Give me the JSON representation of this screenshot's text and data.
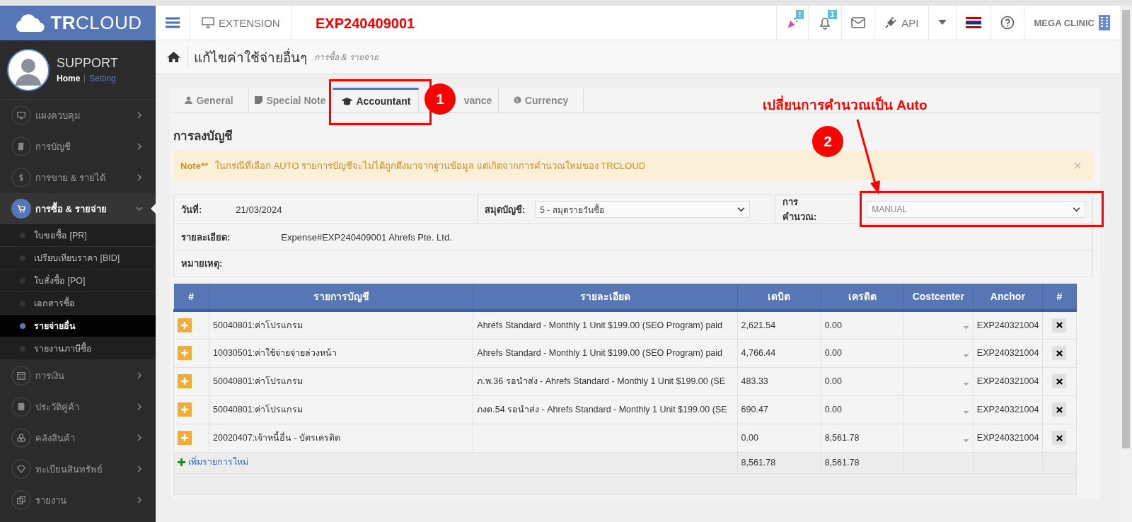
{
  "logo": "**TR**CLOUD",
  "header": {
    "extension": "EXTENSION",
    "items": [
      {
        "kind": "party",
        "badge": "!"
      },
      {
        "kind": "bell",
        "badge": "1"
      },
      {
        "kind": "mail"
      },
      {
        "kind": "api",
        "label": "API"
      },
      {
        "kind": "caret"
      },
      {
        "kind": "flag"
      },
      {
        "kind": "help"
      },
      {
        "kind": "company",
        "label": "MEGA CLINIC"
      }
    ]
  },
  "profile": {
    "name": "SUPPORT",
    "links": [
      {
        "label": "Home",
        "selected": true
      },
      {
        "label": "Setting",
        "selected": false
      }
    ]
  },
  "sidebar": {
    "items": [
      {
        "label": "แผงควบคุม",
        "selected": false,
        "expanded": false
      },
      {
        "label": "การบัญชี",
        "selected": false,
        "expanded": false
      },
      {
        "label": "การขาย & รายได้",
        "selected": false,
        "expanded": false
      },
      {
        "label": "การซื้อ & รายจ่าย",
        "selected": true,
        "expanded": true,
        "children": [
          {
            "label": "ใบขอซื้อ [PR]",
            "selected": false
          },
          {
            "label": "เปรียบเทียบราคา [BID]",
            "selected": false
          },
          {
            "label": "ใบสั่งซื้อ [PO]",
            "selected": false
          },
          {
            "label": "เอกสารซื้อ",
            "selected": false
          },
          {
            "label": "รายจ่ายอื่น",
            "selected": true
          },
          {
            "label": "รายงานภาษีซื้อ",
            "selected": false
          }
        ]
      },
      {
        "label": "การเงิน",
        "selected": false,
        "expanded": false
      },
      {
        "label": "ประวัติคู่ค้า",
        "selected": false,
        "expanded": false
      },
      {
        "label": "คลังสินค้า",
        "selected": false,
        "expanded": false
      },
      {
        "label": "ทะเบียนสินทรัพย์",
        "selected": false,
        "expanded": false
      },
      {
        "label": "รายงาน",
        "selected": false,
        "expanded": false
      }
    ]
  },
  "breadcrumb": {
    "title": "แก้ไขค่าใช้จ่ายอื่นๆ",
    "section": "การซื้อ & รายจ่าย"
  },
  "tabs": [
    {
      "label": "General",
      "selected": false
    },
    {
      "label": "Special Note",
      "selected": false
    },
    {
      "label": "Accountant",
      "selected": true
    },
    {
      "label": "vance",
      "selected": false
    },
    {
      "label": "Currency",
      "selected": false
    }
  ],
  "section_title": "การลงบัญชี",
  "alert": {
    "label": "Note**",
    "text": "ในกรณีที่เลือก AUTO รายการบัญชีจะไม่ได้ถูกดึงมาจากฐานข้อมูล แต่เกิดจากการคำนวณใหม่ของ TRCLOUD",
    "close": "×"
  },
  "form": {
    "date_label": "วันที่:",
    "date": "21/03/2024",
    "book_label": "สมุดบัญชี:",
    "book": "5 - สมุดรายวันซื้อ",
    "calc_label": "การคำนวณ:",
    "calc": "MANUAL",
    "detail_label": "รายละเอียด:",
    "detail": "Expense#EXP240409001  Ahrefs Pte. Ltd.",
    "note_label": "หมายเหตุ:"
  },
  "table": {
    "columns": [
      "#",
      "รายการบัญชี",
      "รายละเอียด",
      "เดบิต",
      "เครดิต",
      "Costcenter",
      "Anchor",
      "#"
    ],
    "rows": [
      {
        "account": "50040801:ค่าโปรแกรม",
        "detail": "Ahrefs Standard - Monthly 1 Unit $199.00 (SEO Program) paid",
        "debit": "2,621.54",
        "credit": "0.00",
        "anchor": "EXP240321004"
      },
      {
        "account": "10030501:ค่าใช้จ่ายจ่ายล่วงหน้า",
        "detail": "Ahrefs Standard - Monthly 1 Unit $199.00 (SEO Program) paid",
        "debit": "4,766.44",
        "credit": "0.00",
        "anchor": "EXP240321004"
      },
      {
        "account": "50040801:ค่าโปรแกรม",
        "detail": "ภ.พ.36 รอนำส่ง - Ahrefs Standard - Monthly 1 Unit $199.00 (SE",
        "debit": "483.33",
        "credit": "0.00",
        "anchor": "EXP240321004"
      },
      {
        "account": "50040801:ค่าโปรแกรม",
        "detail": "ภงด.54 รอนำส่ง - Ahrefs Standard - Monthly 1 Unit $199.00 (SE",
        "debit": "690.47",
        "credit": "0.00",
        "anchor": "EXP240321004"
      },
      {
        "account": "20020407:เจ้าหนี้อื่น - บัตรเครดิต",
        "detail": "",
        "debit": "0.00",
        "credit": "8,561.78",
        "anchor": "EXP240321004"
      }
    ],
    "add_link": "เพิ่มรายการใหม่",
    "total_debit": "8,561.78",
    "total_credit": "8,561.78"
  },
  "annotations": {
    "doc_no": "EXP240409001",
    "step1": "1",
    "step2": "2",
    "note": "เปลี่ยนการคำนวณเป็น Auto"
  }
}
